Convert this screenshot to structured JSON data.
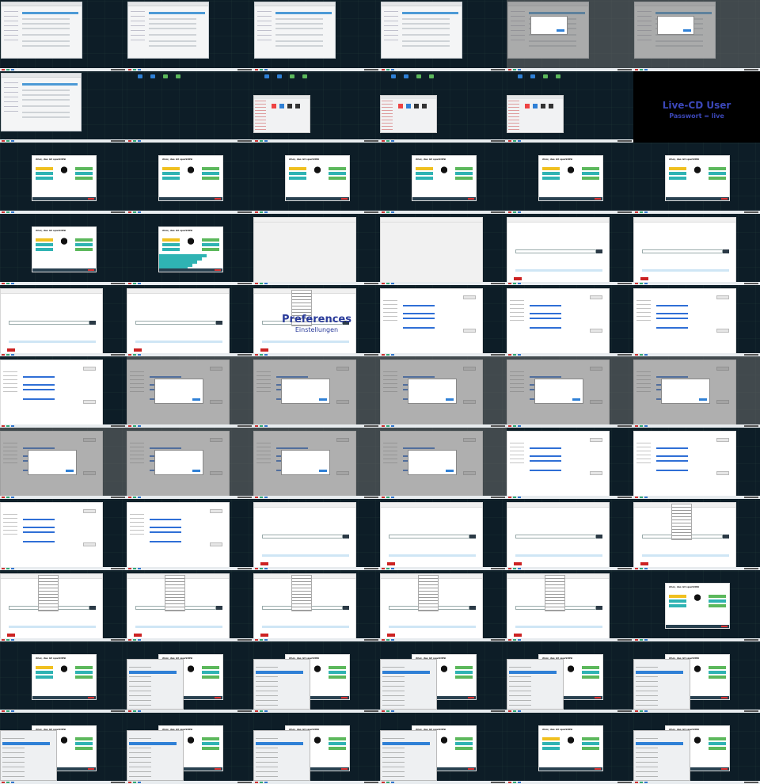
{
  "overlay_text": {
    "preferences_title": "Preferences",
    "preferences_sub": "Einstellungen",
    "live_title": "Live-CD User",
    "live_sub": "Passwort = live"
  },
  "welcome_screen": {
    "heading": "Ahoi, das ist sparkIOSi"
  },
  "colors": {
    "desktop_bg": "#0d1d27",
    "accent_blue": "#2f80d6",
    "teal": "#2fb3b3",
    "green": "#5cb85c",
    "yellow": "#f0c020"
  },
  "grid": {
    "rows": 11,
    "cols": 6
  },
  "cells": [
    {
      "type": "settings-window"
    },
    {
      "type": "settings-window"
    },
    {
      "type": "settings-window"
    },
    {
      "type": "settings-window"
    },
    {
      "type": "dimmed-dialog"
    },
    {
      "type": "dimmed-dialog"
    },
    {
      "type": "settings-window-small"
    },
    {
      "type": "desktop-icons"
    },
    {
      "type": "file-manager"
    },
    {
      "type": "file-manager"
    },
    {
      "type": "file-manager"
    },
    {
      "type": "live-cd"
    },
    {
      "type": "welcome"
    },
    {
      "type": "welcome"
    },
    {
      "type": "welcome"
    },
    {
      "type": "welcome"
    },
    {
      "type": "welcome"
    },
    {
      "type": "welcome"
    },
    {
      "type": "welcome"
    },
    {
      "type": "welcome-expanded"
    },
    {
      "type": "blank-browser"
    },
    {
      "type": "blank-browser"
    },
    {
      "type": "browser"
    },
    {
      "type": "browser"
    },
    {
      "type": "browser"
    },
    {
      "type": "browser"
    },
    {
      "type": "preferences"
    },
    {
      "type": "settings"
    },
    {
      "type": "settings"
    },
    {
      "type": "settings"
    },
    {
      "type": "settings"
    },
    {
      "type": "dimmed-settings"
    },
    {
      "type": "dimmed-settings"
    },
    {
      "type": "dimmed-settings"
    },
    {
      "type": "dimmed-settings"
    },
    {
      "type": "dimmed-settings"
    },
    {
      "type": "dimmed-settings"
    },
    {
      "type": "dimmed-settings"
    },
    {
      "type": "dimmed-settings"
    },
    {
      "type": "dimmed-settings"
    },
    {
      "type": "settings"
    },
    {
      "type": "settings"
    },
    {
      "type": "settings"
    },
    {
      "type": "settings"
    },
    {
      "type": "browser"
    },
    {
      "type": "browser"
    },
    {
      "type": "browser"
    },
    {
      "type": "browser-menu"
    },
    {
      "type": "browser-menu"
    },
    {
      "type": "browser-menu"
    },
    {
      "type": "browser-menu"
    },
    {
      "type": "browser-menu"
    },
    {
      "type": "browser-menu"
    },
    {
      "type": "welcome"
    },
    {
      "type": "welcome"
    },
    {
      "type": "welcome-launcher"
    },
    {
      "type": "welcome-launcher"
    },
    {
      "type": "welcome-launcher"
    },
    {
      "type": "welcome-launcher"
    },
    {
      "type": "welcome-launcher"
    },
    {
      "type": "welcome-launcher"
    },
    {
      "type": "welcome-launcher"
    },
    {
      "type": "welcome-launcher"
    },
    {
      "type": "welcome-launcher"
    },
    {
      "type": "welcome"
    },
    {
      "type": "welcome-launcher"
    }
  ]
}
